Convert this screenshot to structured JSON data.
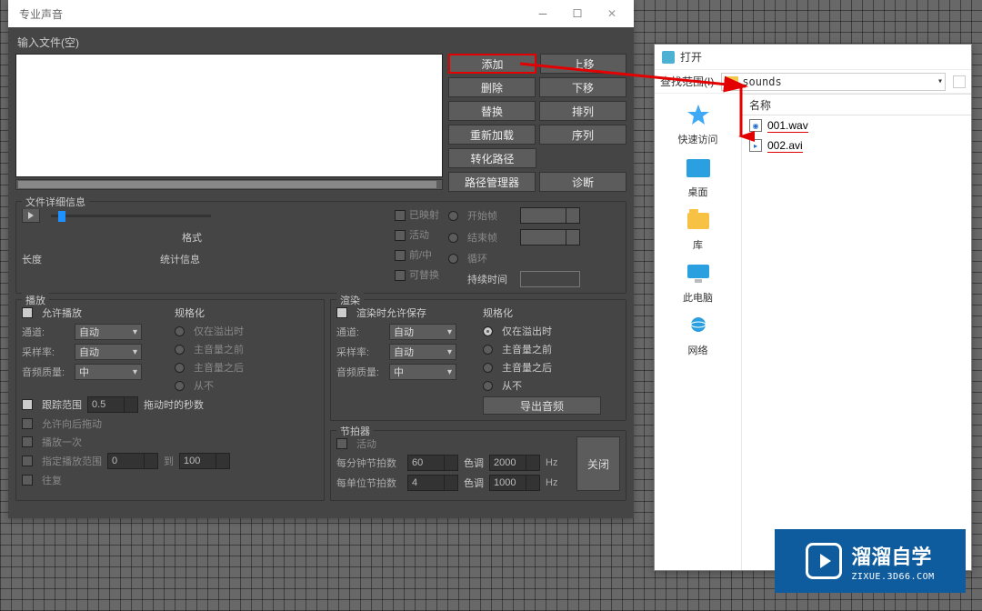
{
  "main_window": {
    "title": "专业声音",
    "input_files_label": "输入文件(空)",
    "buttons": {
      "add": "添加",
      "move_up": "上移",
      "delete": "删除",
      "move_down": "下移",
      "replace": "替换",
      "arrange": "排列",
      "reload": "重新加载",
      "sequence": "序列",
      "convert_path": "转化路径",
      "path_mgr": "路径管理器",
      "diagnose": "诊断"
    },
    "file_detail": {
      "title": "文件详细信息",
      "format": "格式",
      "length": "长度",
      "stats": "统计信息",
      "mapped": "已映射",
      "activity": "活动",
      "pre_mid": "前/中",
      "replaceable": "可替换",
      "start_frame": "开始帧",
      "end_frame": "结束帧",
      "loop": "循环",
      "duration": "持续时间"
    },
    "playback": {
      "title": "播放",
      "allow_play": "允许播放",
      "channel": "通道:",
      "channel_val": "自动",
      "sample_rate": "采样率:",
      "sample_rate_val": "自动",
      "audio_quality": "音频质量:",
      "audio_quality_val": "中",
      "norm": "规格化",
      "norm_overflow": "仅在溢出时",
      "norm_before": "主音量之前",
      "norm_after": "主音量之后",
      "norm_never": "从不",
      "track_range": "跟踪范围",
      "track_range_val": "0.5",
      "drag_seconds": "拖动时的秒数",
      "allow_back_drag": "允许向后拖动",
      "play_once": "播放一次",
      "specify_range": "指定播放范围",
      "range_from": "0",
      "range_to_lbl": "到",
      "range_to": "100",
      "pingpong": "往复"
    },
    "render": {
      "title": "渲染",
      "allow_save": "渲染时允许保存",
      "channel": "通道:",
      "channel_val": "自动",
      "sample_rate": "采样率:",
      "sample_rate_val": "自动",
      "audio_quality": "音频质量:",
      "audio_quality_val": "中",
      "norm": "规格化",
      "norm_overflow": "仅在溢出时",
      "norm_before": "主音量之前",
      "norm_after": "主音量之后",
      "norm_never": "从不",
      "export_audio": "导出音频"
    },
    "metronome": {
      "title": "节拍器",
      "activity": "活动",
      "bpm": "每分钟节拍数",
      "bpm_val": "60",
      "bpm_hue": "色调",
      "bpm_hue_val": "2000",
      "hz": "Hz",
      "bpu": "每单位节拍数",
      "bpu_val": "4",
      "bpu_hue": "色调",
      "bpu_hue_val": "1000",
      "close": "关闭"
    }
  },
  "browser": {
    "title": "打开",
    "range_label": "查找范围(I)",
    "folder": "sounds",
    "name_header": "名称",
    "sidebar": {
      "quick": "快速访问",
      "desktop": "桌面",
      "library": "库",
      "pc": "此电脑",
      "network": "网络"
    },
    "files": {
      "wav": "001.wav",
      "avi": "002.avi"
    }
  },
  "watermark": {
    "brand": "溜溜自学",
    "url": "ZIXUE.3D66.COM"
  }
}
